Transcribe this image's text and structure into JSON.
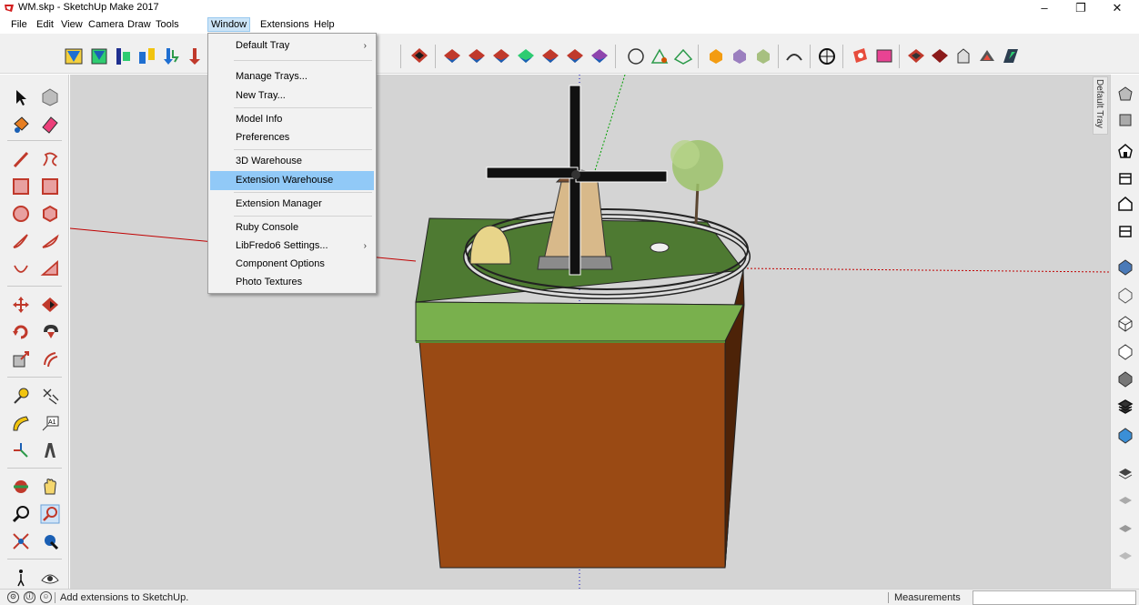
{
  "window": {
    "title": "WM.skp - SketchUp Make 2017",
    "minimize": "–",
    "maximize": "❐",
    "close": "✕"
  },
  "menubar": {
    "items": [
      "File",
      "Edit",
      "View",
      "Camera",
      "Draw",
      "Tools",
      "Window",
      "Extensions",
      "Help"
    ],
    "active": "Window"
  },
  "window_menu": {
    "items": [
      {
        "label": "Default Tray",
        "submenu": true
      },
      {
        "label": "Manage Trays..."
      },
      {
        "label": "New Tray..."
      },
      {
        "label": "Model Info"
      },
      {
        "label": "Preferences"
      },
      {
        "label": "3D Warehouse"
      },
      {
        "label": "Extension Warehouse",
        "highlighted": true
      },
      {
        "label": "Extension Manager"
      },
      {
        "label": "Ruby Console"
      },
      {
        "label": "LibFredo6 Settings...",
        "submenu": true
      },
      {
        "label": "Component Options"
      },
      {
        "label": "Photo Textures"
      }
    ],
    "submenu_arrow": "›"
  },
  "tray": {
    "tab_label": "Default Tray"
  },
  "statusbar": {
    "icons": [
      "geo-location-icon",
      "credits-icon",
      "user-account-icon"
    ],
    "icon_glyphs": [
      "⊙",
      "ⓘ",
      "☺"
    ],
    "text": "Add extensions to SketchUp.",
    "measurements_label": "Measurements",
    "measurements_value": ""
  },
  "colors": {
    "menu_highlight": "#91c9f7",
    "active_menu": "#cce4f7",
    "viewport_bg": "#d4d4d4",
    "grass": "#6fa043",
    "soil": "#9a4a14",
    "axis_red": "#c00000",
    "axis_green": "#00a000",
    "axis_blue": "#0000c0"
  }
}
